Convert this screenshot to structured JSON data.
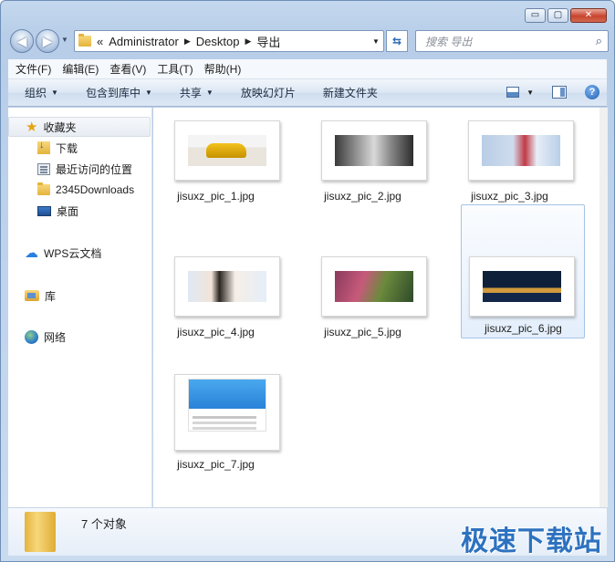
{
  "window": {
    "caption": {
      "minimize": "▭",
      "maximize": "▢",
      "close": "✕"
    }
  },
  "nav": {
    "back_glyph": "◀",
    "forward_glyph": "▶",
    "dropdown_glyph": "▼",
    "breadcrumb_prefix": "«",
    "breadcrumb": [
      "Administrator",
      "Desktop",
      "导出"
    ],
    "breadcrumb_separator": "▶",
    "refresh_glyph": "⇆",
    "search_placeholder": "搜索 导出",
    "search_icon": "⌕"
  },
  "menubar": {
    "items": [
      "文件(F)",
      "编辑(E)",
      "查看(V)",
      "工具(T)",
      "帮助(H)"
    ]
  },
  "toolbar": {
    "organize": "组织",
    "include_in_library": "包含到库中",
    "share": "共享",
    "slideshow": "放映幻灯片",
    "new_folder": "新建文件夹",
    "caret": "▼",
    "help": "?"
  },
  "navpane": {
    "favorites": "收藏夹",
    "downloads": "下载",
    "recent": "最近访问的位置",
    "downloads2345": "2345Downloads",
    "desktop": "桌面",
    "wps_cloud": "WPS云文档",
    "library": "库",
    "network": "网络"
  },
  "files": [
    {
      "name": "jisuxz_pic_1.jpg",
      "icon": "image-thumbnail"
    },
    {
      "name": "jisuxz_pic_2.jpg",
      "icon": "image-thumbnail"
    },
    {
      "name": "jisuxz_pic_3.jpg",
      "icon": "image-thumbnail"
    },
    {
      "name": "jisuxz_pic_4.jpg",
      "icon": "image-thumbnail"
    },
    {
      "name": "jisuxz_pic_5.jpg",
      "icon": "image-thumbnail"
    },
    {
      "name": "jisuxz_pic_6.jpg",
      "icon": "image-thumbnail",
      "selected": true
    },
    {
      "name": "jisuxz_pic_7.jpg",
      "icon": "image-thumbnail"
    }
  ],
  "details": {
    "count": "7 个对象"
  },
  "watermark": "极速下载站",
  "colors": {
    "accent": "#2d72c0",
    "selection": "#cde1f8",
    "frame": "#c4d8ee"
  }
}
